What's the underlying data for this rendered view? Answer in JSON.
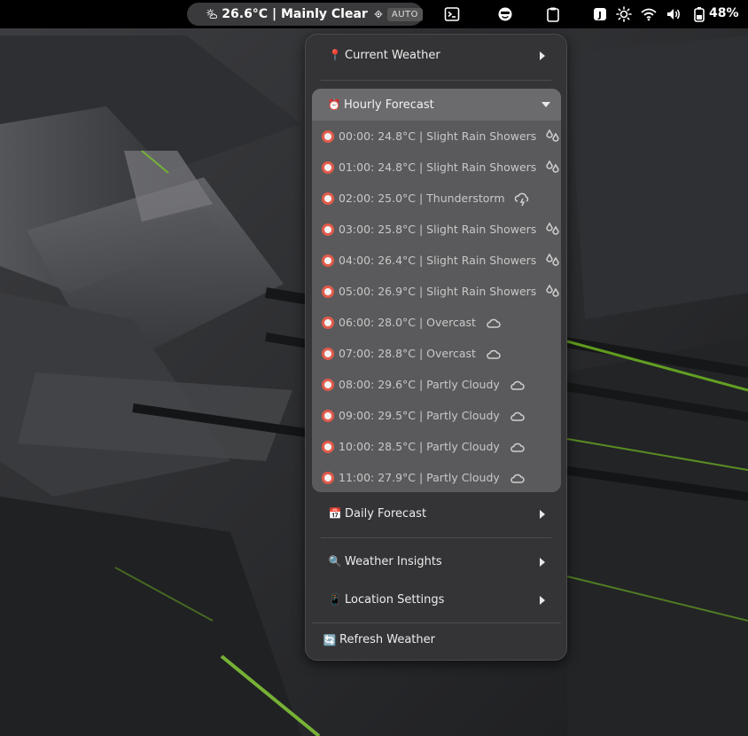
{
  "topbar": {
    "weather_text": "26.6°C | Mainly Clear",
    "auto_label": "AUTO",
    "battery_text": "48%",
    "icons": [
      "partly-sunny-icon",
      "location-target-icon",
      "terminal-icon",
      "smiley-icon",
      "clipboard-icon",
      "keyboard-layout-icon",
      "brightness-icon",
      "wifi-icon",
      "volume-icon",
      "battery-icon"
    ]
  },
  "menu": {
    "current_weather": {
      "emoji": "📍",
      "label": "Current Weather"
    },
    "hourly_header": {
      "emoji": "⏰",
      "label": "Hourly Forecast"
    },
    "hourly": [
      {
        "text": "00:00: 24.8°C | Slight Rain Showers",
        "icon": "rain-drops-icon"
      },
      {
        "text": "01:00: 24.8°C | Slight Rain Showers",
        "icon": "rain-drops-icon"
      },
      {
        "text": "02:00: 25.0°C | Thunderstorm",
        "icon": "thunderstorm-icon"
      },
      {
        "text": "03:00: 25.8°C | Slight Rain Showers",
        "icon": "rain-drops-icon"
      },
      {
        "text": "04:00: 26.4°C | Slight Rain Showers",
        "icon": "rain-drops-icon"
      },
      {
        "text": "05:00: 26.9°C | Slight Rain Showers",
        "icon": "rain-drops-icon"
      },
      {
        "text": "06:00: 28.0°C | Overcast",
        "icon": "cloud-icon"
      },
      {
        "text": "07:00: 28.8°C | Overcast",
        "icon": "cloud-icon"
      },
      {
        "text": "08:00: 29.6°C | Partly Cloudy",
        "icon": "cloud-icon"
      },
      {
        "text": "09:00: 29.5°C | Partly Cloudy",
        "icon": "cloud-icon"
      },
      {
        "text": "10:00: 28.5°C | Partly Cloudy",
        "icon": "cloud-icon"
      },
      {
        "text": "11:00: 27.9°C | Partly Cloudy",
        "icon": "cloud-icon"
      }
    ],
    "daily_forecast": {
      "emoji": "📅",
      "label": "Daily Forecast"
    },
    "weather_insights": {
      "emoji": "🔍",
      "label": "Weather Insights"
    },
    "location_settings": {
      "emoji": "📱",
      "label": "Location Settings"
    },
    "refresh": {
      "emoji": "🔄",
      "label": "Refresh Weather"
    }
  },
  "colors": {
    "topbar_bg": "#000000",
    "menu_bg": "#343436",
    "submenu_bg": "#5a5a5c",
    "accent_green": "#7ed321"
  }
}
